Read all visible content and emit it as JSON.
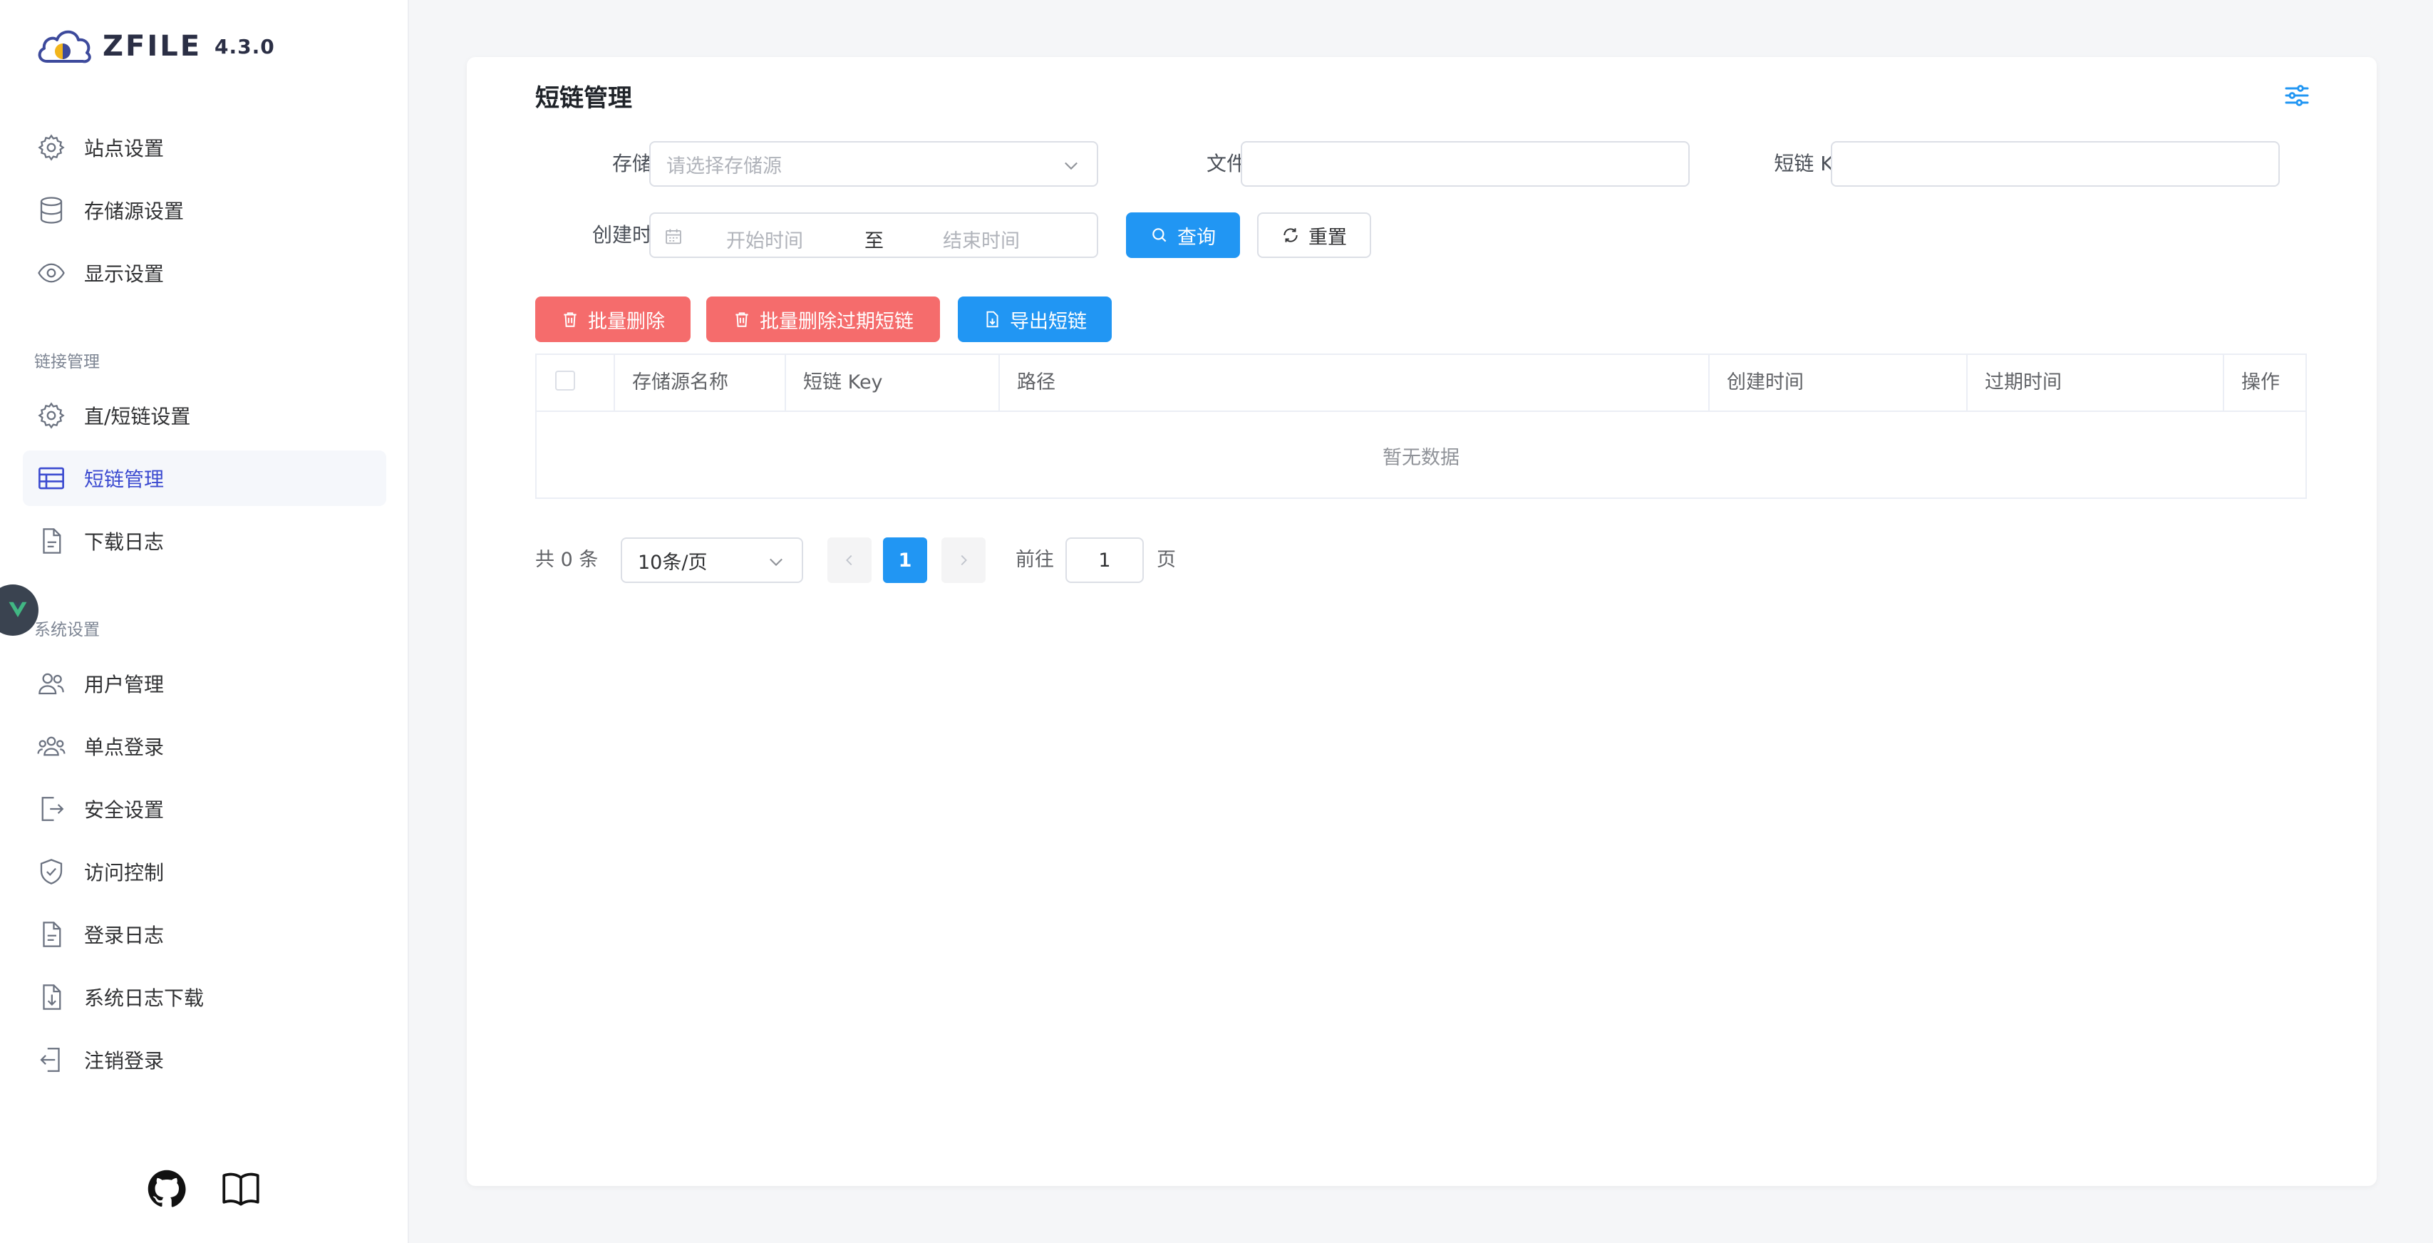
{
  "app": {
    "brand": "ZFILE",
    "version": "4.3.0"
  },
  "sidebar": {
    "items_top": [
      {
        "label": "站点设置",
        "icon": "gear-icon"
      },
      {
        "label": "存储源设置",
        "icon": "database-icon"
      },
      {
        "label": "显示设置",
        "icon": "eye-icon"
      }
    ],
    "group_link": "链接管理",
    "items_link": [
      {
        "label": "直/短链设置",
        "icon": "gear-icon"
      },
      {
        "label": "短链管理",
        "icon": "table-icon",
        "active": true
      },
      {
        "label": "下载日志",
        "icon": "document-icon"
      }
    ],
    "group_system": "系统设置",
    "items_system": [
      {
        "label": "用户管理",
        "icon": "users-icon"
      },
      {
        "label": "单点登录",
        "icon": "group-icon"
      },
      {
        "label": "安全设置",
        "icon": "exit-icon"
      },
      {
        "label": "访问控制",
        "icon": "shield-icon"
      },
      {
        "label": "登录日志",
        "icon": "document-icon"
      },
      {
        "label": "系统日志下载",
        "icon": "download-doc-icon"
      },
      {
        "label": "注销登录",
        "icon": "logout-icon"
      }
    ],
    "footer_icons": [
      "github-icon",
      "book-icon"
    ]
  },
  "main": {
    "title": "短链管理",
    "filters": {
      "storage_label": "存储源",
      "storage_placeholder": "请选择存储源",
      "filename_label": "文件名",
      "filename_value": "",
      "key_label": "短链 Key",
      "key_value": "",
      "created_label": "创建时间",
      "start_placeholder": "开始时间",
      "range_separator": "至",
      "end_placeholder": "结束时间",
      "query_button": "查询",
      "reset_button": "重置"
    },
    "actions": {
      "batch_delete": "批量删除",
      "batch_delete_expired": "批量删除过期短链",
      "export": "导出短链"
    },
    "table": {
      "columns": [
        "存储源名称",
        "短链 Key",
        "路径",
        "创建时间",
        "过期时间",
        "操作"
      ],
      "rows": [],
      "empty_text": "暂无数据"
    },
    "pagination": {
      "total_text": "共 0 条",
      "page_size": "10条/页",
      "current_page": "1",
      "goto_label": "前往",
      "goto_value": "1",
      "page_suffix": "页"
    }
  },
  "colors": {
    "primary": "#2196f3",
    "danger": "#f56c6c",
    "active_text": "#3b4ad0"
  }
}
